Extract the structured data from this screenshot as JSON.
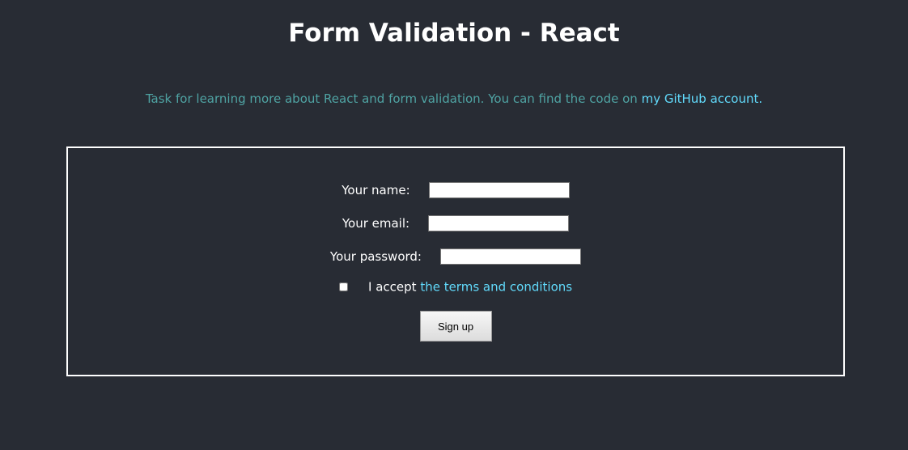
{
  "header": {
    "title": "Form Validation - React"
  },
  "intro": {
    "text": "Task for learning more about React and form validation. You can find the code on ",
    "link_label": "my GitHub account."
  },
  "form": {
    "name_label": "Your name:",
    "name_value": "",
    "email_label": "Your email:",
    "email_value": "",
    "password_label": "Your password:",
    "password_value": "",
    "terms_prefix": "I accept ",
    "terms_link": "the terms and conditions",
    "submit_label": "Sign up"
  },
  "colors": {
    "background": "#282c34",
    "accent_link": "#61dafb",
    "intro_text": "#4fa3a3",
    "border": "#ffffff"
  }
}
